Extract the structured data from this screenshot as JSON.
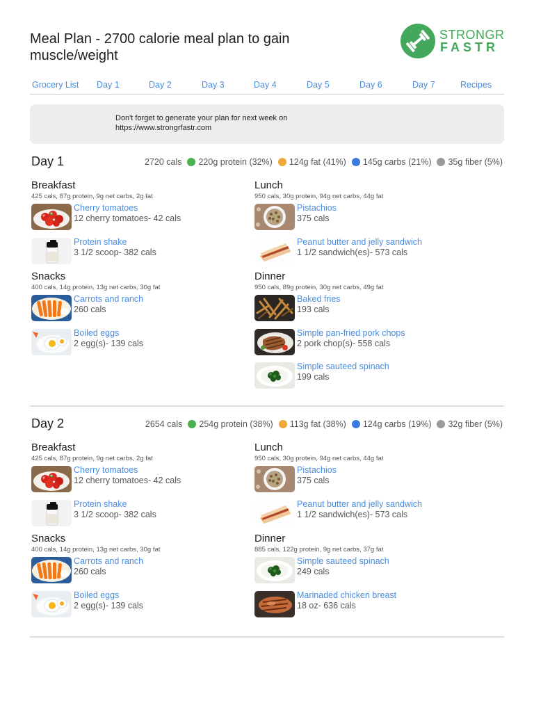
{
  "header": {
    "title": "Meal Plan - 2700 calorie meal plan to gain muscle/weight",
    "logo_line1": "STRONGR",
    "logo_line2": "FASTR"
  },
  "nav": [
    "Grocery List",
    "Day 1",
    "Day 2",
    "Day 3",
    "Day 4",
    "Day 5",
    "Day 6",
    "Day 7",
    "Recipes"
  ],
  "notice": {
    "line1": "Don't forget to generate your plan for next week on",
    "line2": "https://www.strongrfastr.com"
  },
  "colors": {
    "protein": "#4caf50",
    "fat": "#f0a83a",
    "carbs": "#3b7be0",
    "fiber": "#9a9a9a",
    "link": "#4a8de0",
    "brand": "#43a85b"
  },
  "days": [
    {
      "title": "Day 1",
      "cals": "2720 cals",
      "protein": "220g protein (32%)",
      "fat": "124g fat (41%)",
      "carbs": "145g carbs (21%)",
      "fiber": "35g fiber (5%)",
      "meals": [
        {
          "name": "Breakfast",
          "macro": "425 cals, 87g protein, 9g net carbs, 2g fat",
          "foods": [
            {
              "name": "Cherry tomatoes",
              "amount": "12 cherry tomatoes- 42 cals",
              "icon": "cherry-tomatoes"
            },
            {
              "name": "Protein shake",
              "amount": "3 1/2 scoop- 382 cals",
              "icon": "protein-shake"
            }
          ]
        },
        {
          "name": "Snacks",
          "macro": "400 cals, 14g protein, 13g net carbs, 30g fat",
          "foods": [
            {
              "name": "Carrots and ranch",
              "amount": "260 cals",
              "icon": "carrots"
            },
            {
              "name": "Boiled eggs",
              "amount": "2 egg(s)- 139 cals",
              "icon": "boiled-eggs"
            }
          ]
        },
        {
          "name": "Lunch",
          "macro": "950 cals, 30g protein, 94g net carbs, 44g fat",
          "foods": [
            {
              "name": "Pistachios",
              "amount": "375 cals",
              "icon": "pistachios"
            },
            {
              "name": "Peanut butter and jelly sandwich",
              "amount": "1 1/2 sandwich(es)- 573 cals",
              "icon": "sandwich"
            }
          ]
        },
        {
          "name": "Dinner",
          "macro": "950 cals, 89g protein, 30g net carbs, 49g fat",
          "foods": [
            {
              "name": "Baked fries",
              "amount": "193 cals",
              "icon": "fries"
            },
            {
              "name": "Simple pan-fried pork chops",
              "amount": "2 pork chop(s)- 558 cals",
              "icon": "pork-chops"
            },
            {
              "name": "Simple sauteed spinach",
              "amount": "199 cals",
              "icon": "spinach"
            }
          ]
        }
      ]
    },
    {
      "title": "Day 2",
      "cals": "2654 cals",
      "protein": "254g protein (38%)",
      "fat": "113g fat (38%)",
      "carbs": "124g carbs (19%)",
      "fiber": "32g fiber (5%)",
      "meals": [
        {
          "name": "Breakfast",
          "macro": "425 cals, 87g protein, 9g net carbs, 2g fat",
          "foods": [
            {
              "name": "Cherry tomatoes",
              "amount": "12 cherry tomatoes- 42 cals",
              "icon": "cherry-tomatoes"
            },
            {
              "name": "Protein shake",
              "amount": "3 1/2 scoop- 382 cals",
              "icon": "protein-shake"
            }
          ]
        },
        {
          "name": "Snacks",
          "macro": "400 cals, 14g protein, 13g net carbs, 30g fat",
          "foods": [
            {
              "name": "Carrots and ranch",
              "amount": "260 cals",
              "icon": "carrots"
            },
            {
              "name": "Boiled eggs",
              "amount": "2 egg(s)- 139 cals",
              "icon": "boiled-eggs"
            }
          ]
        },
        {
          "name": "Lunch",
          "macro": "950 cals, 30g protein, 94g net carbs, 44g fat",
          "foods": [
            {
              "name": "Pistachios",
              "amount": "375 cals",
              "icon": "pistachios"
            },
            {
              "name": "Peanut butter and jelly sandwich",
              "amount": "1 1/2 sandwich(es)- 573 cals",
              "icon": "sandwich"
            }
          ]
        },
        {
          "name": "Dinner",
          "macro": "885 cals, 122g protein, 9g net carbs, 37g fat",
          "foods": [
            {
              "name": "Simple sauteed spinach",
              "amount": "249 cals",
              "icon": "spinach"
            },
            {
              "name": "Marinaded chicken breast",
              "amount": "18 oz- 636 cals",
              "icon": "chicken"
            }
          ]
        }
      ]
    }
  ]
}
